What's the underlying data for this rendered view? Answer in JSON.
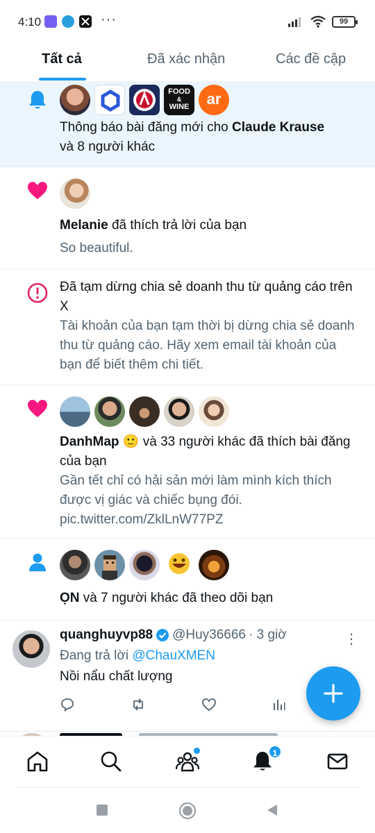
{
  "status_bar": {
    "time": "4:10",
    "battery": "99",
    "more": "···"
  },
  "tabs": [
    {
      "label": "Tất cả",
      "active": true
    },
    {
      "label": "Đã xác nhận",
      "active": false
    },
    {
      "label": "Các đề cập",
      "active": false
    }
  ],
  "notifications": [
    {
      "type": "new-post",
      "icon": "bell-icon",
      "text_prefix": "Thông báo bài đăng mới cho ",
      "name": "Claude Krause",
      "text_suffix": "và 8 người khác",
      "avatar_labels": {
        "food_wine_line1": "FOOD",
        "food_wine_amp": "&",
        "food_wine_line2": "WINE",
        "ar": "ar"
      }
    },
    {
      "type": "like-reply",
      "icon": "heart-icon",
      "name": "Melanie",
      "text": " đã thích trả lời của bạn",
      "sub": "So beautiful."
    },
    {
      "type": "alert",
      "icon": "alert-circle-icon",
      "title": "Đã tạm dừng chia sẻ doanh thu từ quảng cáo trên X",
      "sub": "Tài khoản của bạn tạm thời bị dừng chia sẻ doanh thu từ quảng cáo. Hãy xem email tài khoản của bạn để biết thêm chi tiết."
    },
    {
      "type": "like-post",
      "icon": "heart-icon",
      "name": "DanhMap",
      "emoji": "🙂",
      "text": " và 33 người khác đã thích bài đăng của bạn",
      "sub": "Gần tết chỉ có hải sản mới làm mình kích thích được vị giác và chiếc bụng đói. pic.twitter.com/ZklLnW77PZ"
    },
    {
      "type": "follow",
      "icon": "person-icon",
      "name": "ỌN",
      "text": " và 7 người khác đã theo dõi bạn"
    }
  ],
  "tweet": {
    "name": "quanghuyvp88",
    "handle": "@Huy36666",
    "time": "· 3 giờ",
    "reply_prefix": "Đang trả lời ",
    "reply_to": "@ChauXMEN",
    "body": "Nồi nẩu chất lượng",
    "more": "⋮"
  },
  "bottom_nav": {
    "notification_count": "1"
  },
  "colors": {
    "accent": "#1d9bf0",
    "like": "#f91880",
    "alert": "#e0245e",
    "highlight_bg": "#eaf5fd"
  }
}
